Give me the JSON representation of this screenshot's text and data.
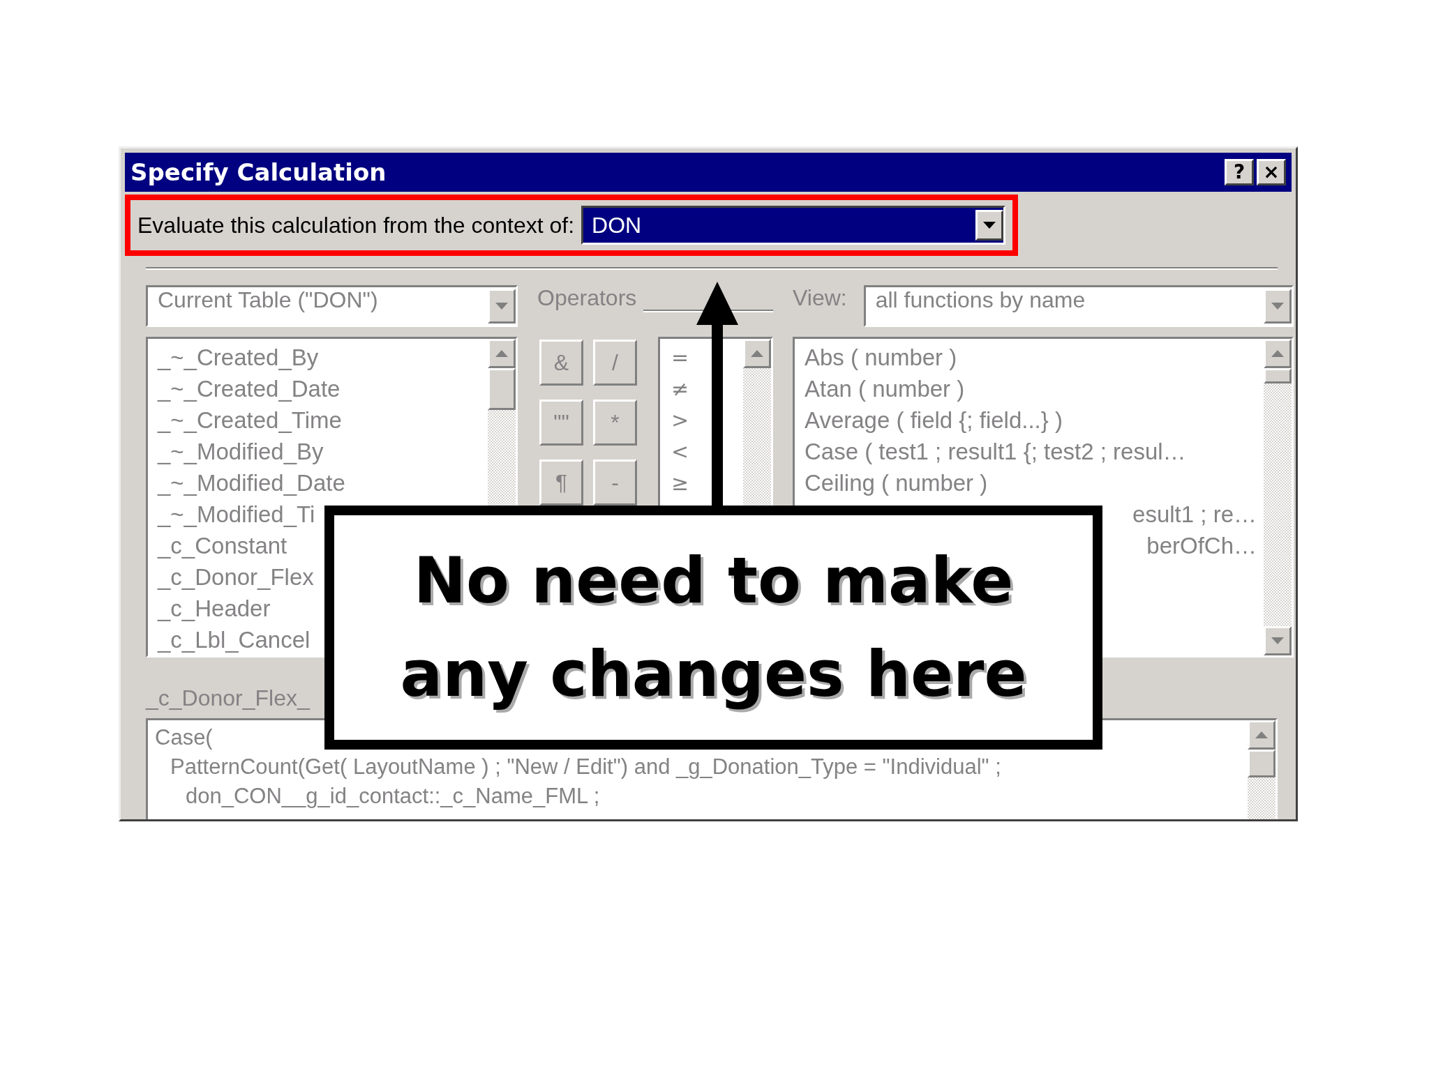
{
  "window": {
    "title": "Specify Calculation",
    "buttons": [
      "?",
      "×"
    ]
  },
  "context": {
    "label": "Evaluate this calculation from the context of:",
    "value": "DON",
    "highlighted": true
  },
  "table_select": {
    "value": "Current Table (\"DON\")"
  },
  "fields": [
    "_~_Created_By",
    "_~_Created_Date",
    "_~_Created_Time",
    "_~_Modified_By",
    "_~_Modified_Date",
    "_~_Modified_Ti",
    "_c_Constant",
    "_c_Donor_Flex",
    "_c_Header",
    "_c_Lbl_Cancel"
  ],
  "operators": {
    "label": "Operators",
    "buttons": [
      "&",
      "/",
      "\"\"",
      "*",
      "¶",
      "-"
    ],
    "list": [
      "=",
      "≠",
      ">",
      "<",
      "≥"
    ]
  },
  "view": {
    "label": "View:",
    "value": "all functions by name"
  },
  "functions": [
    {
      "text": "Abs ( number )",
      "kind": "full"
    },
    {
      "text": "Atan ( number )",
      "kind": "full"
    },
    {
      "text": "Average ( field {; field...} )",
      "kind": "full"
    },
    {
      "text": "Case ( test1 ; result1 {; test2 ; resul…",
      "kind": "full"
    },
    {
      "text": "Ceiling ( number )",
      "kind": "full"
    },
    {
      "text": "esult1 ; re…",
      "kind": "tail"
    },
    {
      "text": "berOfCh…",
      "kind": "tail"
    }
  ],
  "formula": {
    "label": "_c_Donor_Flex_",
    "lines": [
      {
        "text": "Case(",
        "kind": "top"
      },
      {
        "text": "PatternCount(Get( LayoutName ) ; \"New / Edit\") and _g_Donation_Type = \"Individual\" ;",
        "kind": "inner"
      },
      {
        "text": "don_CON__g_id_contact::_c_Name_FML ;",
        "kind": "deeper"
      }
    ]
  },
  "callout": {
    "lines": [
      "No need to make",
      "any changes here"
    ]
  }
}
